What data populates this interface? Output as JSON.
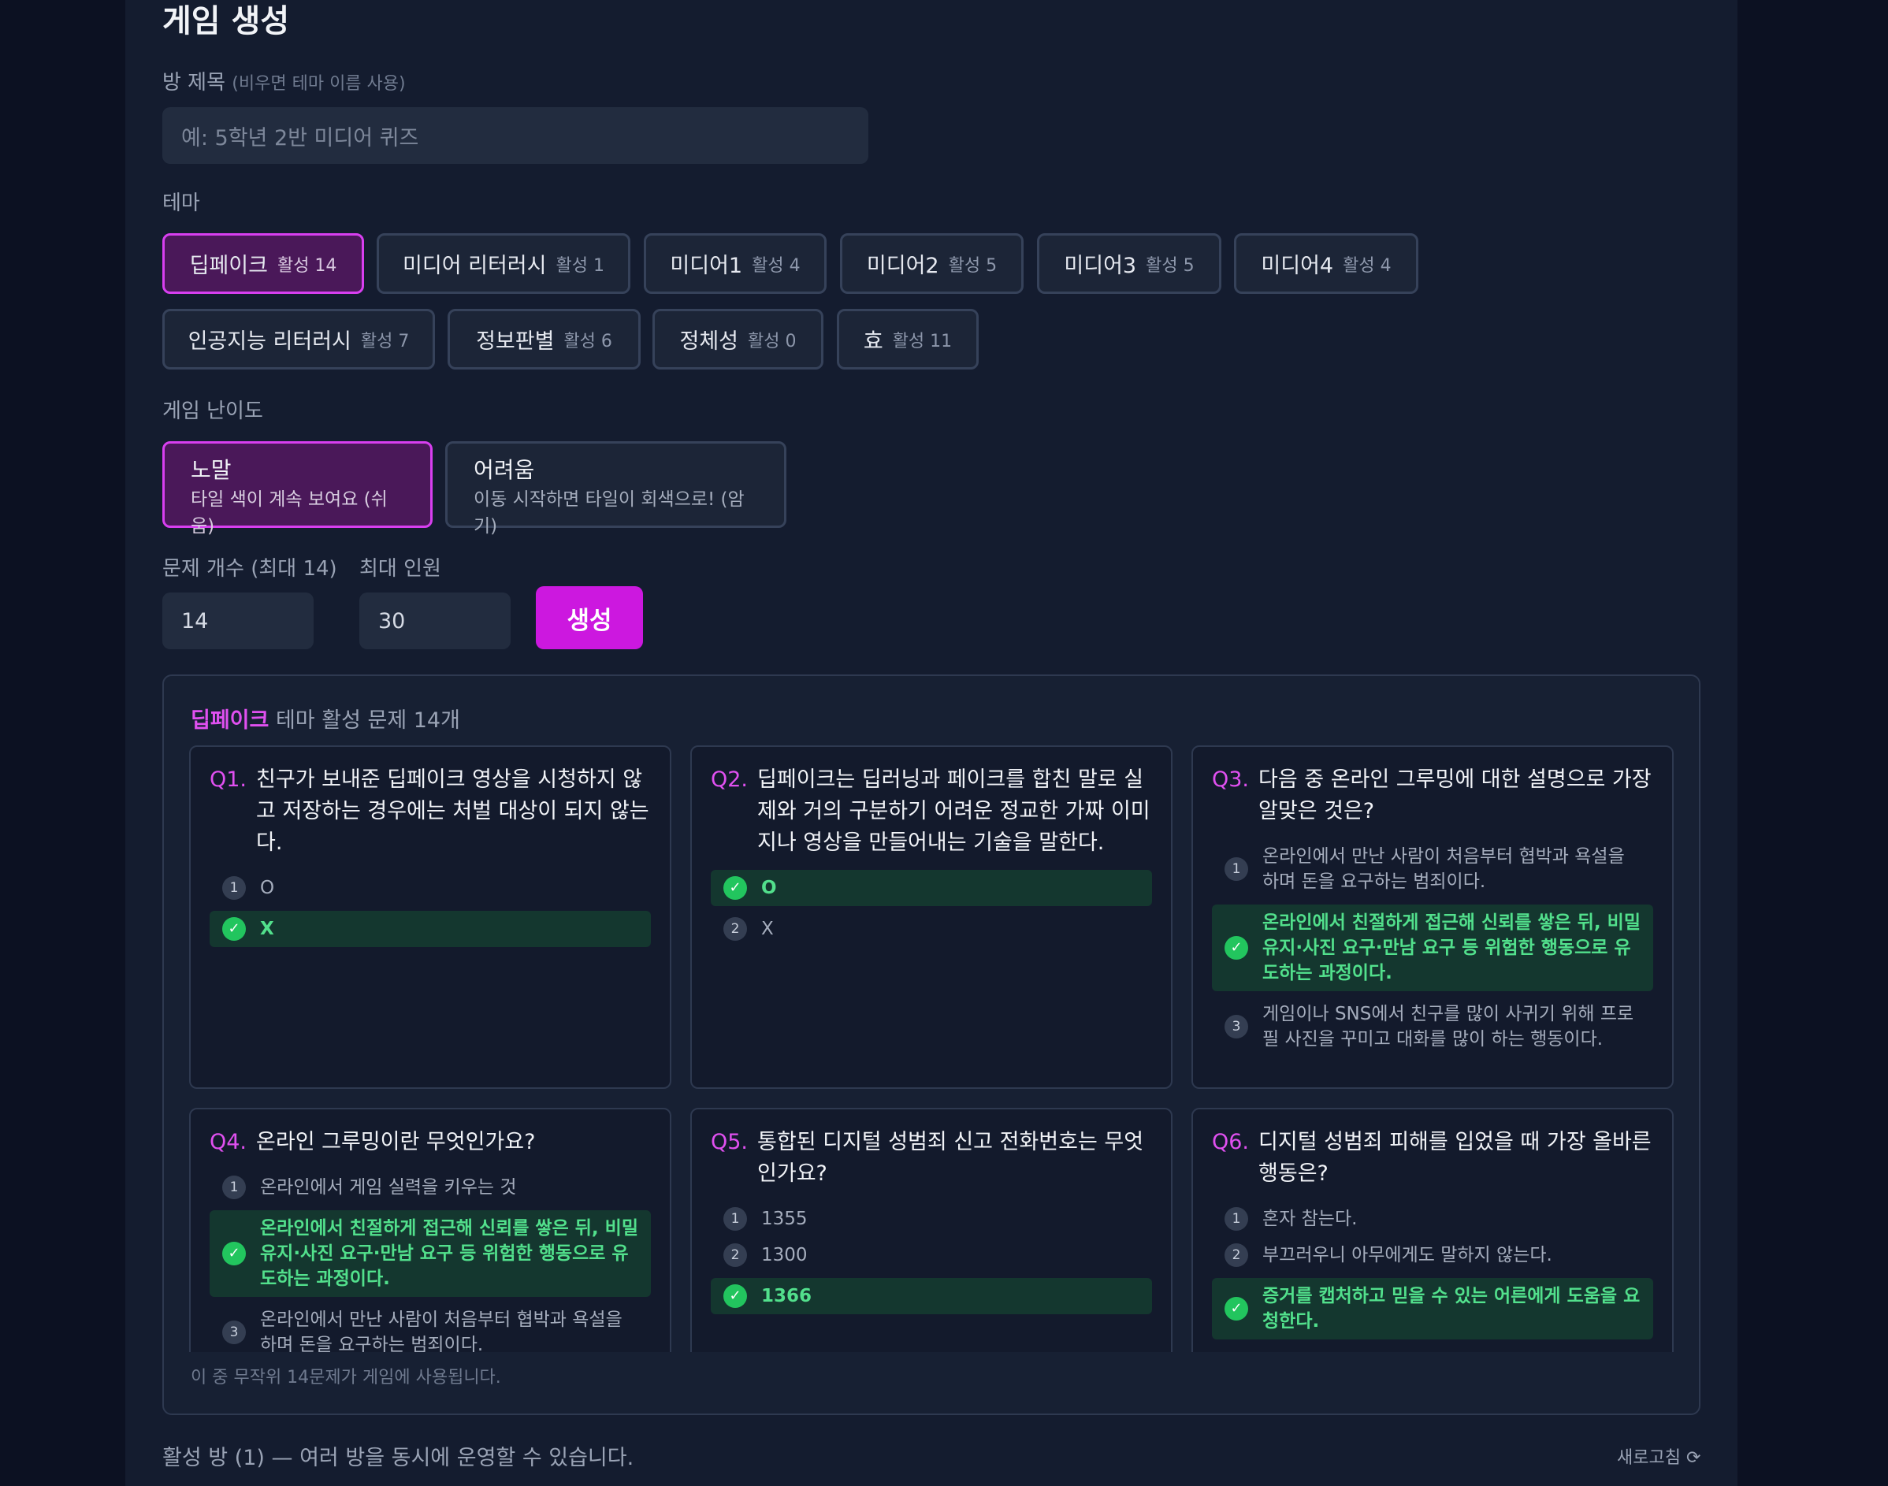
{
  "page_title": "게임 생성",
  "room_title": {
    "label": "방 제목",
    "hint": "(비우면 테마 이름 사용)",
    "placeholder": "예: 5학년 2반 미디어 퀴즈"
  },
  "theme": {
    "label": "테마",
    "items": [
      {
        "name": "딥페이크",
        "count": "활성 14",
        "selected": true
      },
      {
        "name": "미디어 리터러시",
        "count": "활성 1"
      },
      {
        "name": "미디어1",
        "count": "활성 4"
      },
      {
        "name": "미디어2",
        "count": "활성 5"
      },
      {
        "name": "미디어3",
        "count": "활성 5"
      },
      {
        "name": "미디어4",
        "count": "활성 4"
      },
      {
        "name": "인공지능 리터러시",
        "count": "활성 7"
      },
      {
        "name": "정보판별",
        "count": "활성 6"
      },
      {
        "name": "정체성",
        "count": "활성 0"
      },
      {
        "name": "효",
        "count": "활성 11"
      }
    ]
  },
  "difficulty": {
    "label": "게임 난이도",
    "items": [
      {
        "title": "노말",
        "desc": "타일 색이 계속 보여요 (쉬움)",
        "selected": true
      },
      {
        "title": "어려움",
        "desc": "이동 시작하면 타일이 회색으로! (암기)"
      }
    ]
  },
  "question_count": {
    "label": "문제 개수 (최대 14)",
    "value": "14"
  },
  "max_players": {
    "label": "최대 인원",
    "value": "30"
  },
  "create_button": "생성",
  "summary": {
    "theme_name": "딥페이크",
    "text": "테마 활성 문제 14개"
  },
  "questions": [
    {
      "num": "Q1.",
      "text": "친구가 보내준 딥페이크 영상을 시청하지 않고 저장하는 경우에는 처벌 대상이 되지 않는다.",
      "options": [
        {
          "mark": "1",
          "text": "O"
        },
        {
          "mark": "✓",
          "text": "X",
          "correct": true
        }
      ]
    },
    {
      "num": "Q2.",
      "text": "딥페이크는 딥러닝과 페이크를 합친 말로 실제와 거의 구분하기 어려운 정교한 가짜 이미지나 영상을 만들어내는 기술을 말한다.",
      "options": [
        {
          "mark": "✓",
          "text": "O",
          "correct": true
        },
        {
          "mark": "2",
          "text": "X"
        }
      ]
    },
    {
      "num": "Q3.",
      "text": "다음 중 온라인 그루밍에 대한 설명으로 가장 알맞은 것은?",
      "options": [
        {
          "mark": "1",
          "text": "온라인에서 만난 사람이 처음부터 협박과 욕설을 하며 돈을 요구하는 범죄이다."
        },
        {
          "mark": "✓",
          "text": "온라인에서 친절하게 접근해 신뢰를 쌓은 뒤, 비밀 유지·사진 요구·만남 요구 등 위험한 행동으로 유도하는 과정이다.",
          "correct": true
        },
        {
          "mark": "3",
          "text": "게임이나 SNS에서 친구를 많이 사귀기 위해 프로필 사진을 꾸미고 대화를 많이 하는 행동이다."
        }
      ]
    },
    {
      "num": "Q4.",
      "text": "온라인 그루밍이란 무엇인가요?",
      "options": [
        {
          "mark": "1",
          "text": "온라인에서 게임 실력을 키우는 것"
        },
        {
          "mark": "✓",
          "text": "온라인에서 친절하게 접근해 신뢰를 쌓은 뒤, 비밀 유지·사진 요구·만남 요구 등 위험한 행동으로 유도하는 과정이다.",
          "correct": true
        },
        {
          "mark": "3",
          "text": "온라인에서 만난 사람이 처음부터 협박과 욕설을 하며 돈을 요구하는 범죄이다."
        }
      ]
    },
    {
      "num": "Q5.",
      "text": "통합된 디지털 성범죄 신고 전화번호는 무엇인가요?",
      "options": [
        {
          "mark": "1",
          "text": "1355"
        },
        {
          "mark": "2",
          "text": "1300"
        },
        {
          "mark": "✓",
          "text": "1366",
          "correct": true
        }
      ]
    },
    {
      "num": "Q6.",
      "text": "디지털 성범죄 피해를 입었을 때 가장 올바른 행동은?",
      "options": [
        {
          "mark": "1",
          "text": "혼자 참는다."
        },
        {
          "mark": "2",
          "text": "부끄러우니 아무에게도 말하지 않는다."
        },
        {
          "mark": "✓",
          "text": "증거를 캡처하고 믿을 수 있는 어른에게 도움을 요청한다.",
          "correct": true
        }
      ]
    }
  ],
  "footnote": "이 중 무작위 14문제가 게임에 사용됩니다.",
  "active_rooms": "활성 방 (1) — 여러 방을 동시에 운영할 수 있습니다.",
  "refresh": "새로고침 ⟳",
  "colors": {
    "accent": "#cc18df",
    "accent_border": "#d83ff0",
    "correct": "#22c55e",
    "correct_text": "#52e08c",
    "background": "#0c1122",
    "panel": "#141c2f"
  }
}
